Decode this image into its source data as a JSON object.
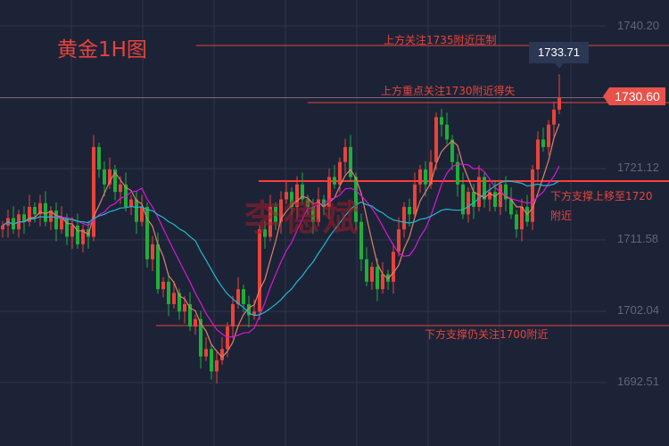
{
  "title": "黄金1H图",
  "watermark": "李德斌",
  "chart_data": {
    "type": "candlestick",
    "title": "黄金1H图",
    "y_ticks": [
      "1740.20",
      "1721.12",
      "1711.58",
      "1702.04",
      "1692.51"
    ],
    "y_tick_values": [
      1740.2,
      1721.12,
      1711.58,
      1702.04,
      1692.51
    ],
    "ylim": [
      1688,
      1744
    ],
    "grid": true,
    "first_open": 1713,
    "closes": [
      1713.5,
      1714.5,
      1713,
      1715,
      1714,
      1716,
      1715,
      1716.5,
      1714,
      1715.5,
      1713,
      1714.5,
      1712,
      1713.5,
      1711,
      1713,
      1712,
      1724,
      1721,
      1719,
      1721,
      1718,
      1719,
      1716,
      1717,
      1714,
      1716,
      1709,
      1711,
      1705,
      1706,
      1703,
      1704.5,
      1702,
      1703,
      1700,
      1701,
      1696,
      1697,
      1694,
      1695.5,
      1697,
      1700,
      1703,
      1705,
      1703,
      1701.5,
      1702,
      1713,
      1712,
      1716,
      1714,
      1717,
      1718,
      1716,
      1719,
      1717,
      1716,
      1714,
      1717,
      1716,
      1720,
      1719,
      1722,
      1724,
      1720,
      1714,
      1709,
      1706,
      1708,
      1705,
      1707,
      1706,
      1710,
      1713,
      1716,
      1715,
      1719,
      1721,
      1719,
      1722,
      1728,
      1727,
      1725,
      1722,
      1719,
      1715,
      1718,
      1716,
      1720,
      1717,
      1718,
      1716,
      1719,
      1717,
      1715,
      1713,
      1716,
      1714,
      1721,
      1725,
      1724,
      1727,
      1729,
      1730.6
    ],
    "last_high": 1733.71,
    "current_price": "1730.60",
    "high_label": "1733.71",
    "moving_averages": [
      {
        "name": "MA5",
        "period": 5,
        "color": "#e0806a"
      },
      {
        "name": "MA10",
        "period": 10,
        "color": "#d41ad4"
      },
      {
        "name": "MA20",
        "period": 20,
        "color": "#22b8cc"
      }
    ],
    "up_color": "#e8433a",
    "down_color": "#1fae3a",
    "annotations": [
      {
        "text": "上方关注1735附近压制",
        "level": 1735
      },
      {
        "text": "上方重点关注1730附近得失",
        "level": 1730
      },
      {
        "text": "下方支撑上移至1720",
        "text2": "附近",
        "level": 1720
      },
      {
        "text": "下方支撑仍关注1700附近",
        "level": 1700
      }
    ]
  }
}
